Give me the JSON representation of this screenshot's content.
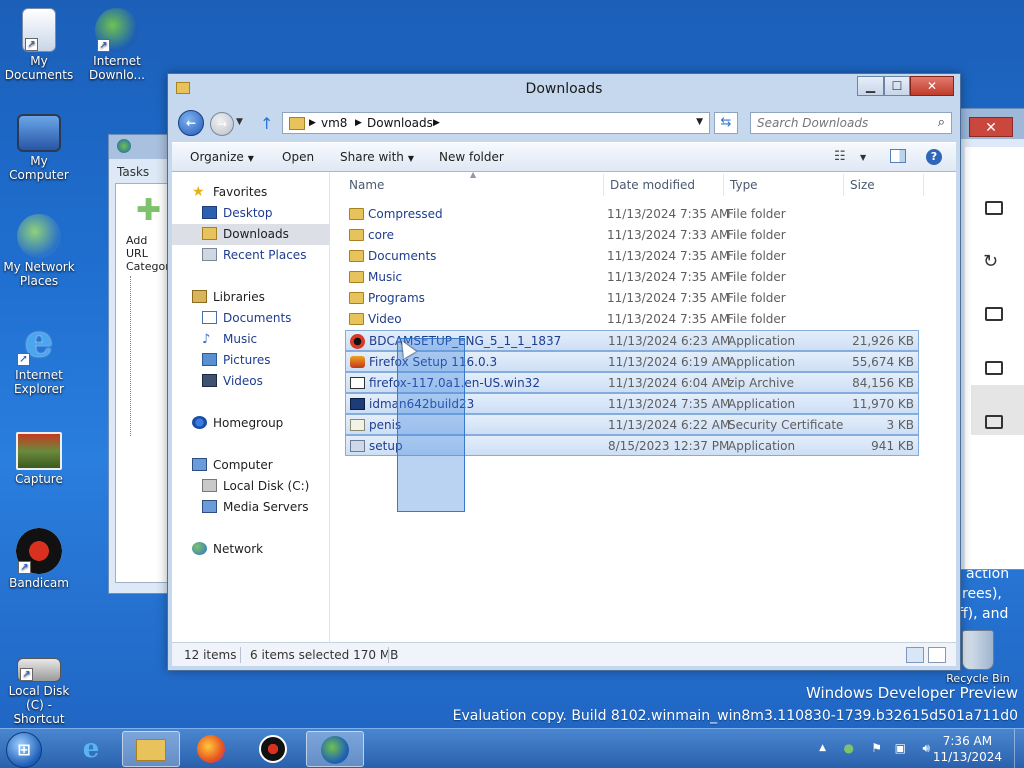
{
  "desktop": {
    "icons": [
      {
        "label": "My Documents",
        "icon": "my-documents-icon"
      },
      {
        "label": "Internet Downlo...",
        "icon": "internet-download-manager-icon"
      },
      {
        "label": "My Computer",
        "icon": "my-computer-icon"
      },
      {
        "label": "My Network Places",
        "icon": "network-places-icon"
      },
      {
        "label": "Internet Explorer",
        "icon": "internet-explorer-icon"
      },
      {
        "label": "Capture",
        "icon": "capture-image-icon"
      },
      {
        "label": "Bandicam",
        "icon": "bandicam-icon"
      },
      {
        "label": "Local Disk (C) - Shortcut",
        "icon": "local-disk-shortcut-icon"
      },
      {
        "label": "Recycle Bin",
        "icon": "recycle-bin-icon"
      }
    ],
    "watermark": {
      "line1": "Windows Developer Preview",
      "line2": "Evaluation copy. Build 8102.winmain_win8m3.110830-1739.b32615d501a711d0"
    },
    "peek_text": [
      "action",
      "rees),",
      "ff), and"
    ]
  },
  "back_window_left": {
    "tab": "Tasks",
    "add_url": "Add URL",
    "category": "Categori"
  },
  "explorer": {
    "title": "Downloads",
    "address": {
      "crumbs": [
        "vm8",
        "Downloads"
      ]
    },
    "search": {
      "placeholder": "Search Downloads"
    },
    "toolbar": {
      "organize": "Organize",
      "open": "Open",
      "share_with": "Share with",
      "new_folder": "New folder"
    },
    "nav": {
      "favorites": "Favorites",
      "desktop": "Desktop",
      "downloads": "Downloads",
      "recent_places": "Recent Places",
      "libraries": "Libraries",
      "documents": "Documents",
      "music": "Music",
      "pictures": "Pictures",
      "videos": "Videos",
      "homegroup": "Homegroup",
      "computer": "Computer",
      "local_disk": "Local Disk (C:)",
      "media_servers": "Media Servers",
      "network": "Network"
    },
    "columns": {
      "name": "Name",
      "date": "Date modified",
      "type": "Type",
      "size": "Size"
    },
    "files": [
      {
        "name": "Compressed",
        "date": "11/13/2024 7:35 AM",
        "type": "File folder",
        "size": "",
        "icon": "folder-icon",
        "selected": false
      },
      {
        "name": "core",
        "date": "11/13/2024 7:33 AM",
        "type": "File folder",
        "size": "",
        "icon": "folder-icon",
        "selected": false
      },
      {
        "name": "Documents",
        "date": "11/13/2024 7:35 AM",
        "type": "File folder",
        "size": "",
        "icon": "folder-icon",
        "selected": false
      },
      {
        "name": "Music",
        "date": "11/13/2024 7:35 AM",
        "type": "File folder",
        "size": "",
        "icon": "folder-icon",
        "selected": false
      },
      {
        "name": "Programs",
        "date": "11/13/2024 7:35 AM",
        "type": "File folder",
        "size": "",
        "icon": "folder-icon",
        "selected": false
      },
      {
        "name": "Video",
        "date": "11/13/2024 7:35 AM",
        "type": "File folder",
        "size": "",
        "icon": "folder-icon",
        "selected": false
      },
      {
        "name": "BDCAMSETUP_ENG_5_1_1_1837",
        "date": "11/13/2024 6:23 AM",
        "type": "Application",
        "size": "21,926 KB",
        "icon": "bandicam-setup-icon",
        "selected": true
      },
      {
        "name": "Firefox Setup 116.0.3",
        "date": "11/13/2024 6:19 AM",
        "type": "Application",
        "size": "55,674 KB",
        "icon": "firefox-setup-icon",
        "selected": true
      },
      {
        "name": "firefox-117.0a1.en-US.win32",
        "date": "11/13/2024 6:04 AM",
        "type": "zip Archive",
        "size": "84,156 KB",
        "icon": "zip-archive-icon",
        "selected": true
      },
      {
        "name": "idman642build23",
        "date": "11/13/2024 7:35 AM",
        "type": "Application",
        "size": "11,970 KB",
        "icon": "idm-installer-icon",
        "selected": true
      },
      {
        "name": "penis",
        "date": "11/13/2024 6:22 AM",
        "type": "Security Certificate",
        "size": "3 KB",
        "icon": "certificate-icon",
        "selected": true
      },
      {
        "name": "setup",
        "date": "8/15/2023 12:37 PM",
        "type": "Application",
        "size": "941 KB",
        "icon": "setup-icon",
        "selected": true
      }
    ],
    "status": {
      "count": "12 items",
      "selected": "6 items selected 170 MB"
    }
  },
  "taskbar": {
    "clock_time": "7:36 AM",
    "clock_date": "11/13/2024",
    "apps": [
      "start-orb-icon",
      "internet-explorer-icon",
      "file-explorer-icon",
      "firefox-icon",
      "bandicam-icon",
      "internet-download-manager-icon"
    ]
  },
  "colors": {
    "selection": "#cddff5",
    "accent": "#1e3d8f",
    "taskbar": "#2a61ad"
  }
}
